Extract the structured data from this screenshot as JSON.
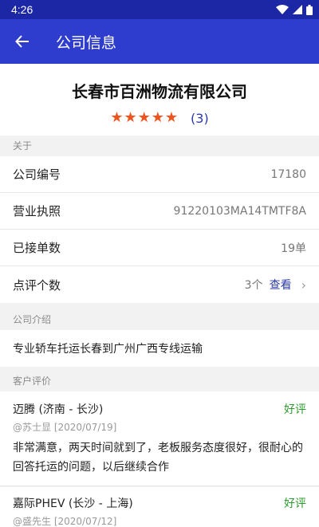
{
  "status_bar": {
    "time": "4:26"
  },
  "app_bar": {
    "title": "公司信息"
  },
  "company": {
    "name": "长春市百洲物流有限公司",
    "stars": 5,
    "review_count": "(3)"
  },
  "sections": {
    "about": "关于",
    "intro": "公司介绍",
    "reviews": "客户评价"
  },
  "info_rows": {
    "company_no": {
      "label": "公司编号",
      "value": "17180"
    },
    "license": {
      "label": "营业执照",
      "value": "91220103MA14TMTF8A"
    },
    "orders": {
      "label": "已接单数",
      "value": "19单"
    },
    "reviews": {
      "label": "点评个数",
      "value": "3个",
      "link": "查看"
    }
  },
  "intro_text": "专业轿车托运长春到广州广西专线运输",
  "reviews": [
    {
      "title": "迈腾 (济南 - 长沙)",
      "tag": "好评",
      "meta": "@苏士显 [2020/07/19]",
      "body": "非常满意，两天时间就到了，老板服务态度很好，很耐心的回答托运的问题，以后继续合作"
    },
    {
      "title": "嘉际PHEV (长沙 - 上海)",
      "tag": "好评",
      "meta": "@盛先生 [2020/07/12]",
      "body": ""
    }
  ],
  "colors": {
    "app_bar": "#2f3dcf",
    "status_bar": "#1c27a6",
    "star": "#f0541e",
    "link": "#2b3aa8",
    "positive_tag": "#2e9b2e"
  }
}
